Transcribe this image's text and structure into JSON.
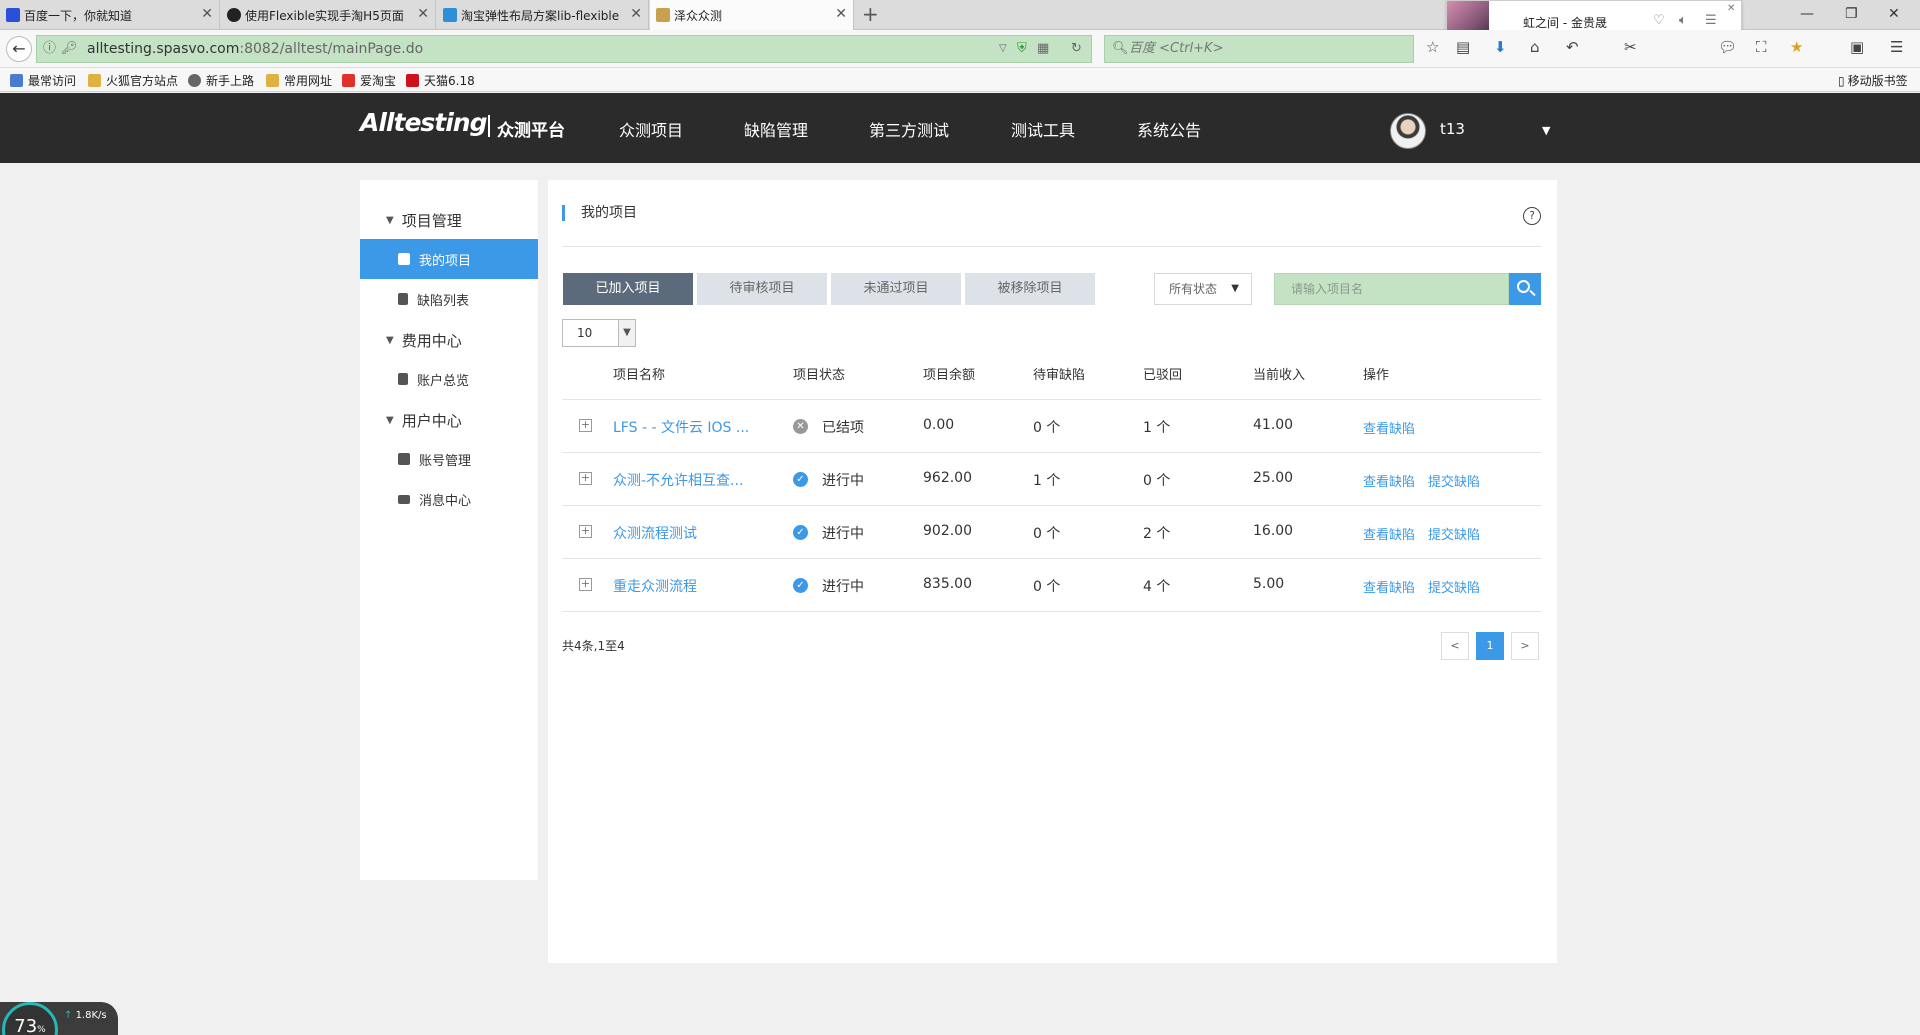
{
  "browser": {
    "tabs": [
      {
        "title": "百度一下，你就知道",
        "favicon_color": "#2b4fd8"
      },
      {
        "title": "使用Flexible实现手淘H5页面",
        "favicon_color": "#222222"
      },
      {
        "title": "淘宝弹性布局方案lib-flexible",
        "favicon_color": "#2d8fd5"
      },
      {
        "title": "泽众众测",
        "favicon_color": "#c8a050"
      }
    ],
    "new_tab": "+",
    "media": {
      "title": "虹之间 - 金贵晟"
    },
    "address": {
      "domain": "alltesting.spasvo.com",
      "path": ":8082/alltest/mainPage.do"
    },
    "search_placeholder": "百度 <Ctrl+K>",
    "bookmarks": [
      {
        "label": "最常访问",
        "color": "#4a7bd0"
      },
      {
        "label": "火狐官方站点",
        "color": "#e0b040"
      },
      {
        "label": "新手上路",
        "color": "#666666"
      },
      {
        "label": "常用网址",
        "color": "#e0b040"
      },
      {
        "label": "爱淘宝",
        "color": "#e0302a"
      },
      {
        "label": "天猫6.18",
        "color": "#d0101a"
      }
    ],
    "mobile_bookmarks": "移动版书签"
  },
  "header": {
    "logo": "Alltesting",
    "platform": "众测平台",
    "nav": [
      "众测项目",
      "缺陷管理",
      "第三方测试",
      "测试工具",
      "系统公告"
    ],
    "username": "t13"
  },
  "sidebar": {
    "groups": [
      {
        "label": "项目管理",
        "items": [
          "我的项目",
          "缺陷列表"
        ]
      },
      {
        "label": "费用中心",
        "items": [
          "账户总览"
        ]
      },
      {
        "label": "用户中心",
        "items": [
          "账号管理",
          "消息中心"
        ]
      }
    ]
  },
  "main": {
    "title": "我的项目",
    "help": "?",
    "tabs": [
      "已加入项目",
      "待审核项目",
      "未通过项目",
      "被移除项目"
    ],
    "status_filter": "所有状态",
    "search_placeholder": "请输入项目名",
    "page_size": "10",
    "columns": [
      "项目名称",
      "项目状态",
      "项目余额",
      "待审缺陷",
      "已驳回",
      "当前收入",
      "操作"
    ],
    "rows": [
      {
        "name": "LFS - - 文件云 IOS ...",
        "status": "已结项",
        "status_type": "closed",
        "balance": "0.00",
        "pending": "0 个",
        "rejected": "1 个",
        "income": "41.00",
        "actions": [
          "查看缺陷"
        ]
      },
      {
        "name": "众测-不允许相互查...",
        "status": "进行中",
        "status_type": "active",
        "balance": "962.00",
        "pending": "1 个",
        "rejected": "0 个",
        "income": "25.00",
        "actions": [
          "查看缺陷",
          "提交缺陷"
        ]
      },
      {
        "name": "众测流程测试",
        "status": "进行中",
        "status_type": "active",
        "balance": "902.00",
        "pending": "0 个",
        "rejected": "2 个",
        "income": "16.00",
        "actions": [
          "查看缺陷",
          "提交缺陷"
        ]
      },
      {
        "name": "重走众测流程",
        "status": "进行中",
        "status_type": "active",
        "balance": "835.00",
        "pending": "0 个",
        "rejected": "4 个",
        "income": "5.00",
        "actions": [
          "查看缺陷",
          "提交缺陷"
        ]
      }
    ],
    "summary": "共4条,1至4",
    "pagination": {
      "prev": "<",
      "current": "1",
      "next": ">"
    }
  },
  "widget": {
    "percent": "73",
    "percent_unit": "%",
    "rate": "1.8K/s"
  },
  "colors": {
    "accent": "#3b99e8",
    "header_bg": "#2b2b2b",
    "tab_active": "#5b6b7b",
    "field_bg": "#c4e3c4"
  }
}
